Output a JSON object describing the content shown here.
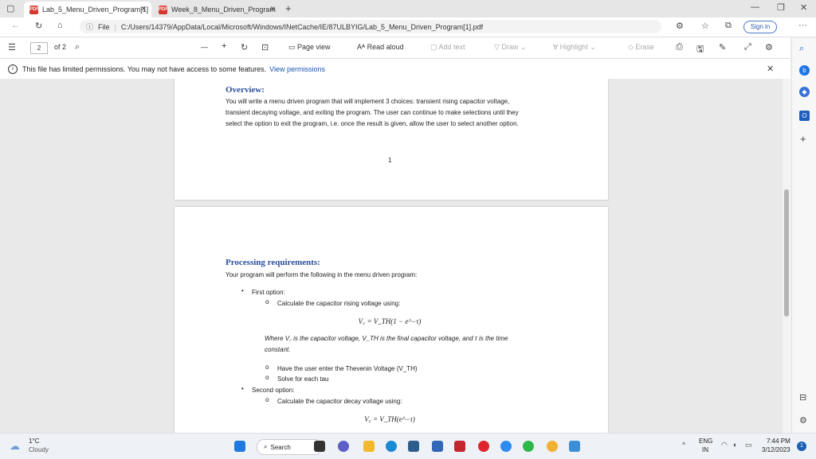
{
  "browser": {
    "tabs": [
      {
        "title": "Lab_5_Menu_Driven_Program[1]",
        "active": true
      },
      {
        "title": "Week_8_Menu_Driven_Program",
        "active": false
      }
    ],
    "new_tab": "+",
    "url_scheme": "File",
    "url": "C:/Users/14379/AppData/Local/Microsoft/Windows/INetCache/IE/87ULBYIG/Lab_5_Menu_Driven_Program[1].pdf",
    "sign_in": "Sign in",
    "more": "···"
  },
  "pdf_toolbar": {
    "page_current": "2",
    "page_total": "of 2",
    "zoom_out": "—",
    "zoom_in": "+",
    "page_view": "Page view",
    "read_aloud": "Read aloud",
    "add_text": "Add text",
    "draw": "Draw",
    "highlight": "Highlight",
    "erase": "Erase"
  },
  "infobar": {
    "message": "This file has limited permissions. You may not have access to some features.",
    "link": "View permissions"
  },
  "document": {
    "page1": {
      "heading": "Overview:",
      "lines": [
        "You will write a menu driven program that will implement 3 choices: transient rising capacitor voltage,",
        "transient decaying voltage, and exiting the program.  The user can continue to make selections until they",
        "select the option to exit the program, i.e. once the result is given, allow the user to select another option."
      ],
      "page_number": "1"
    },
    "page2": {
      "heading": "Processing requirements:",
      "intro": "Your program will perform the following in the menu driven program:",
      "first_option": "First option:",
      "calc_rising": "Calculate the capacitor rising voltage using:",
      "eq_rising": "V꜀ = V_TH(1 − e^−τ)",
      "where_line1": "Where V꜀ is the capacitor voltage, V_TH is the final capacitor voltage, and τ is the time",
      "where_line2": "constant.",
      "sub1": "Have the user enter the Thevenin Voltage (V_TH)",
      "sub2": "Solve for each tau",
      "second_option": "Second option:",
      "calc_decay": "Calculate the capacitor decay voltage using:",
      "eq_decay": "V꜀ = V_TH(e^−τ)"
    }
  },
  "taskbar": {
    "weather_temp": "1°C",
    "weather_desc": "Cloudy",
    "search": "Search",
    "lang_top": "ENG",
    "lang_bottom": "IN",
    "time": "7:44 PM",
    "date": "3/12/2023",
    "notif_count": "1"
  }
}
